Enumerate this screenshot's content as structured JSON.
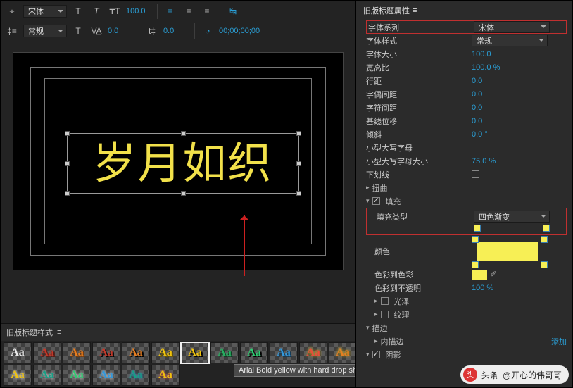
{
  "toolbar": {
    "font_family": "宋体",
    "font_style": "常规",
    "font_size": "100.0",
    "kerning": "0.0",
    "leading": "0.0",
    "timecode": "00;00;00;00"
  },
  "canvas": {
    "title_text": "岁月如织"
  },
  "styles_panel": {
    "header": "旧版标题样式",
    "menu_icon": "≡",
    "tooltip": "Arial Bold yellow with hard drop shadow",
    "swatches": [
      {
        "label": "Aa",
        "color": "#e8e8e8",
        "shadow": "rgba(0,0,0,0)"
      },
      {
        "label": "Aa",
        "color": "#c0392b",
        "shadow": "2px 2px 0 #5a1b14"
      },
      {
        "label": "Aa",
        "color": "#e67e22",
        "shadow": "2px 2px 0 #7a3d0c"
      },
      {
        "label": "Aa",
        "color": "#c0392b",
        "shadow": "2px 2px 0 #000"
      },
      {
        "label": "Aa",
        "color": "#e67e22",
        "shadow": "2px 2px 0 #000"
      },
      {
        "label": "Aa",
        "color": "#f1c40f",
        "shadow": "2px 2px 0 #6b5600"
      },
      {
        "label": "Aa",
        "color": "#f1c40f",
        "shadow": "2px 2px 0 #000"
      },
      {
        "label": "Aa",
        "color": "#27ae60",
        "shadow": "2px 2px 0 #0d4023"
      },
      {
        "label": "Aa",
        "color": "#2ecc71",
        "shadow": "2px 2px 0 #000"
      },
      {
        "label": "Aa",
        "color": "#3498db",
        "shadow": "2px 2px 0 #123a57"
      },
      {
        "label": "Aa",
        "color": "#e74c3c",
        "shadow": "0 0 4px #f1c40f"
      },
      {
        "label": "Aa",
        "color": "#e67e22",
        "shadow": "0 0 4px #f1c40f"
      },
      {
        "label": "Aa",
        "color": "#f1c40f",
        "shadow": "0 0 4px #fff"
      },
      {
        "label": "Aa",
        "color": "#16a085",
        "shadow": "0 0 4px #fff"
      },
      {
        "label": "Aa",
        "color": "#2ecc71",
        "shadow": "0 0 4px #fff"
      },
      {
        "label": "Aa",
        "color": "#3498db",
        "shadow": "0 0 4px #fff"
      },
      {
        "label": "Aa",
        "color": "#16a085",
        "shadow": "0 0 3px #3498db"
      },
      {
        "label": "Aa",
        "color": "#f1c40f",
        "shadow": "0 0 3px #e74c3c"
      }
    ],
    "selected_index": 6
  },
  "properties": {
    "header": "旧版标题属性",
    "menu_icon": "≡",
    "rows": {
      "font_family_label": "字体系列",
      "font_family_value": "宋体",
      "font_style_label": "字体样式",
      "font_style_value": "常规",
      "font_size_label": "字体大小",
      "font_size_value": "100.0",
      "aspect_label": "宽高比",
      "aspect_value": "100.0 %",
      "leading_label": "行距",
      "leading_value": "0.0",
      "pair_kern_label": "字偶间距",
      "pair_kern_value": "0.0",
      "tracking_label": "字符间距",
      "tracking_value": "0.0",
      "baseline_label": "基线位移",
      "baseline_value": "0.0",
      "slant_label": "倾斜",
      "slant_value": "0.0 °",
      "small_caps_label": "小型大写字母",
      "small_caps_size_label": "小型大写字母大小",
      "small_caps_size_value": "75.0 %",
      "underline_label": "下划线",
      "distort_label": "扭曲",
      "fill_label": "填充",
      "fill_type_label": "填充类型",
      "fill_type_value": "四色渐变",
      "color_label": "颜色",
      "c2c_label": "色彩到色彩",
      "c2o_label": "色彩到不透明",
      "c2o_value": "100 %",
      "sheen_label": "光泽",
      "texture_label": "纹理",
      "strokes_label": "描边",
      "inner_stroke_label": "内描边",
      "inner_stroke_action": "添加",
      "shadow_label": "阴影"
    }
  },
  "watermark": {
    "logo": "头",
    "label": "头条",
    "user": "@开心的伟哥哥"
  }
}
